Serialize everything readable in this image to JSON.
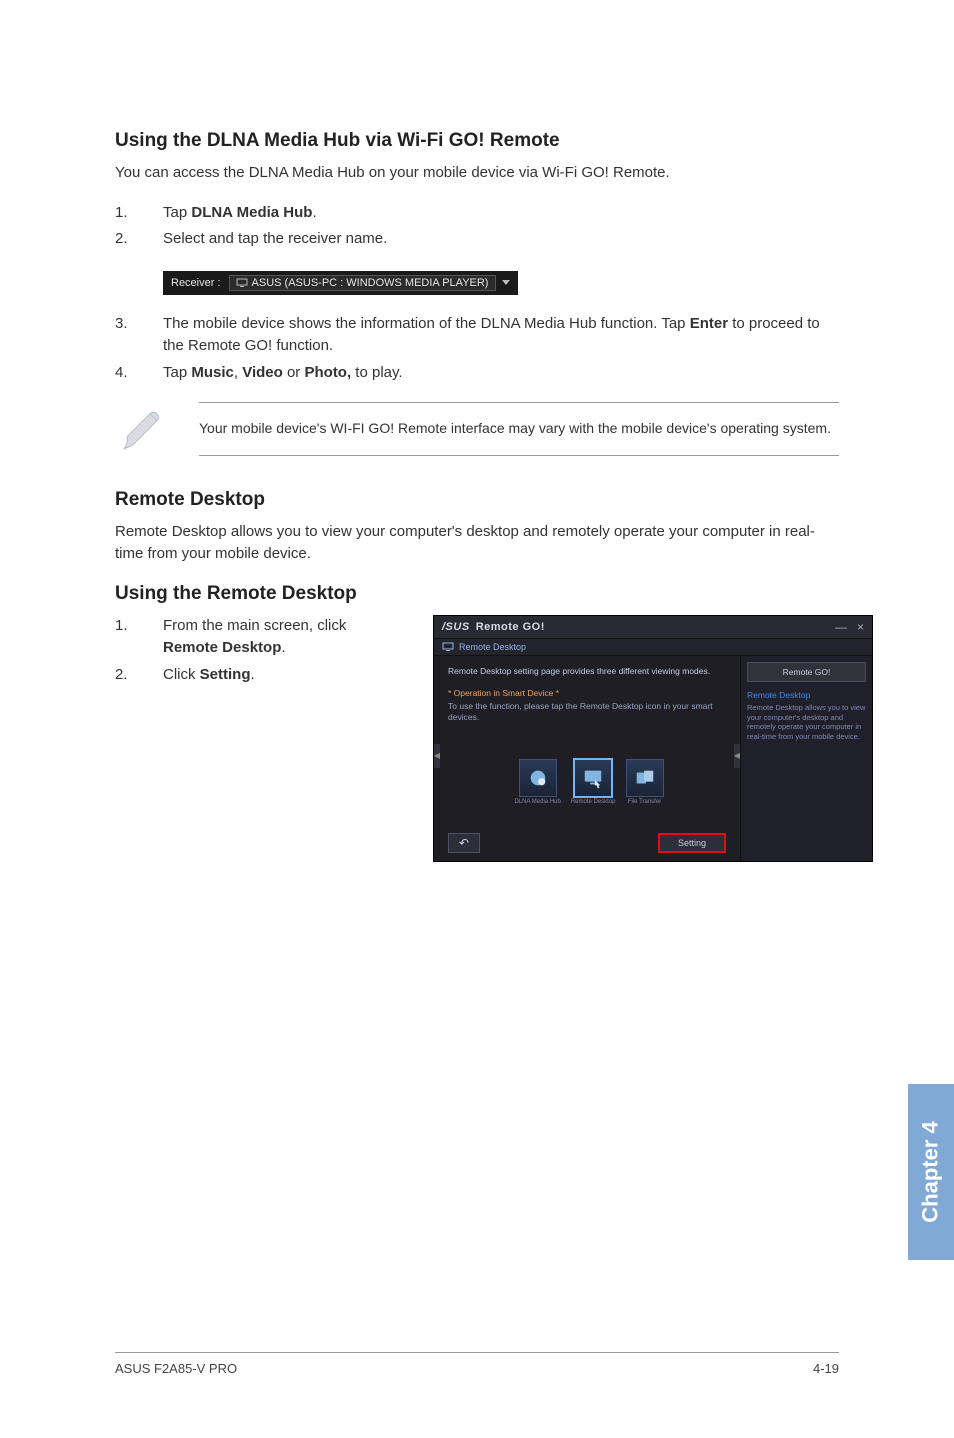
{
  "section1": {
    "heading": "Using the DLNA Media Hub via Wi-Fi GO! Remote",
    "intro": "You can access the DLNA Media Hub on your mobile device via Wi-Fi GO! Remote.",
    "steps12": [
      {
        "n": "1.",
        "pre": "Tap ",
        "bold": "DLNA Media Hub",
        "post": "."
      },
      {
        "n": "2.",
        "pre": "Select and tap the receiver name.",
        "bold": "",
        "post": ""
      }
    ],
    "receiver_label": "Receiver :",
    "receiver_value": "ASUS (ASUS-PC : WINDOWS MEDIA PLAYER)",
    "steps34": [
      {
        "n": "3.",
        "t_pre": "The mobile device shows the information of the DLNA Media Hub function. Tap ",
        "t_b1": "Enter",
        "t_post": " to proceed to the Remote GO! function."
      },
      {
        "n": "4.",
        "t_pre": "Tap ",
        "t_b1": "Music",
        "t_mid1": ", ",
        "t_b2": "Video",
        "t_mid2": " or ",
        "t_b3": "Photo,",
        "t_post": " to play."
      }
    ],
    "note": "Your mobile device's WI-FI GO! Remote interface may vary with the mobile device's operating system."
  },
  "section2": {
    "heading": "Remote Desktop",
    "intro": "Remote Desktop allows you to view your computer's desktop and remotely operate your computer in real-time from your mobile device."
  },
  "section3": {
    "heading": "Using the Remote Desktop",
    "steps": [
      {
        "n": "1.",
        "pre": "From the main screen, click ",
        "bold": "Remote Desktop",
        "post": "."
      },
      {
        "n": "2.",
        "pre": "Click ",
        "bold": "Setting",
        "post": "."
      }
    ]
  },
  "app": {
    "brand": "/SUS",
    "title": "Remote GO!",
    "min": "—",
    "close": "×",
    "breadcrumb": "Remote Desktop",
    "desc1": "Remote Desktop setting page provides three different viewing modes.",
    "op_head": "* Operation in Smart Device *",
    "op_body": "To use the function, please tap the Remote Desktop icon in your smart devices.",
    "thumbs": [
      "DLNA Media Hub",
      "Remote Desktop",
      "File Transfer"
    ],
    "back": "↶",
    "setting": "Setting",
    "side_btn": "Remote GO!",
    "side_title": "Remote Desktop",
    "side_desc": "Remote Desktop allows you to view your computer's desktop and remotely operate your computer in real-time from your mobile device."
  },
  "chapter_tab": "Chapter 4",
  "footer": {
    "left": "ASUS F2A85-V PRO",
    "right": "4-19"
  }
}
